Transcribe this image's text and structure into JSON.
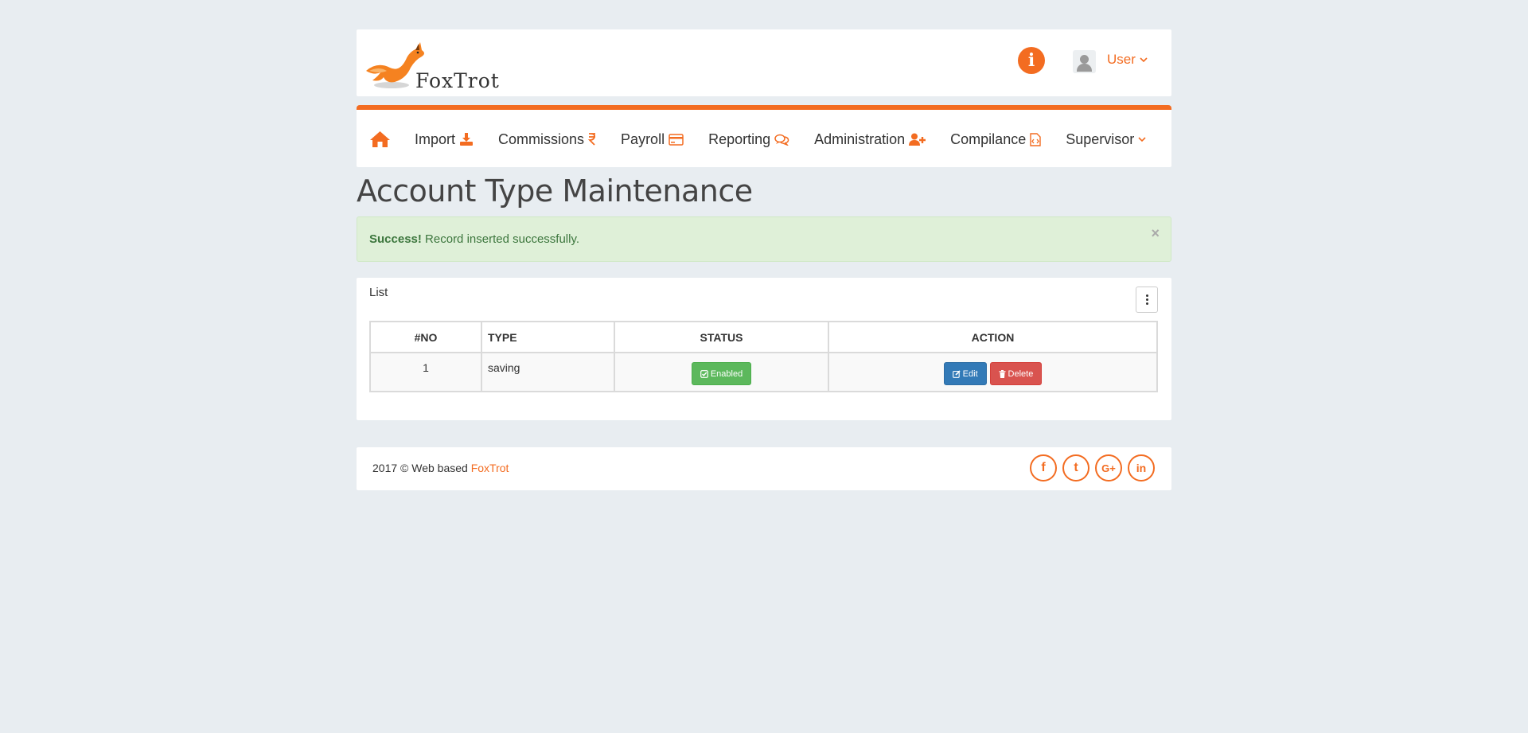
{
  "header": {
    "logo_text": "FoxTrot",
    "user_label": "User"
  },
  "nav": {
    "items": [
      {
        "label": "Import"
      },
      {
        "label": "Commissions"
      },
      {
        "label": "Payroll"
      },
      {
        "label": "Reporting"
      },
      {
        "label": "Administration"
      },
      {
        "label": "Compilance"
      },
      {
        "label": "Supervisor"
      }
    ]
  },
  "page": {
    "title": "Account Type Maintenance"
  },
  "alert": {
    "strong": "Success!",
    "message": "Record inserted successfully.",
    "close": "×"
  },
  "panel": {
    "title": "List",
    "table": {
      "headers": [
        "#NO",
        "TYPE",
        "STATUS",
        "ACTION"
      ],
      "rows": [
        {
          "no": "1",
          "type": "saving",
          "status": "Enabled",
          "edit": "Edit",
          "delete": "Delete"
        }
      ]
    }
  },
  "footer": {
    "copyright": "2017 © Web based",
    "brand": "FoxTrot",
    "socials": [
      "f",
      "t",
      "G+",
      "in"
    ]
  },
  "colors": {
    "accent": "#f36c21",
    "success": "#5cb85c",
    "primary": "#337ab7",
    "danger": "#d9534f",
    "alert_bg": "#dff0d8"
  }
}
